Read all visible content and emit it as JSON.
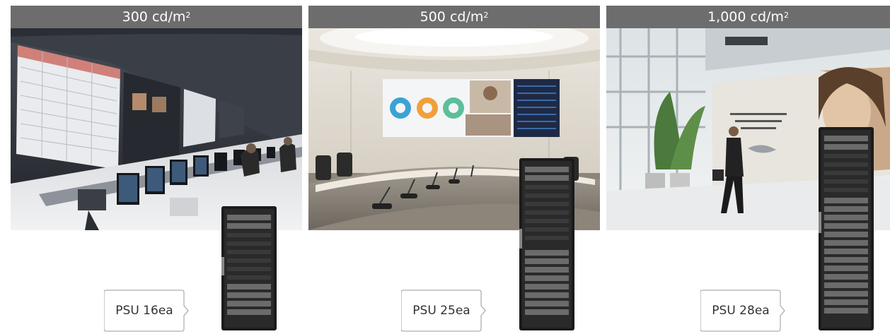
{
  "panels": [
    {
      "brightness_value": "300",
      "brightness_unit": "cd/m",
      "brightness_sup": "2",
      "psu_label": "PSU 16ea"
    },
    {
      "brightness_value": "500",
      "brightness_unit": "cd/m",
      "brightness_sup": "2",
      "psu_label": "PSU 25ea"
    },
    {
      "brightness_value": "1,000",
      "brightness_unit": "cd/m",
      "brightness_sup": "2",
      "psu_label": "PSU 28ea"
    }
  ],
  "colors": {
    "header_bg": "#6d6d6d",
    "header_text": "#ffffff",
    "rack_body": "#1b1b1b",
    "callout_border": "#9a9a9a"
  },
  "images": [
    {
      "icon": "control-room-photo-icon"
    },
    {
      "icon": "conference-room-photo-icon"
    },
    {
      "icon": "retail-lobby-photo-icon"
    }
  ]
}
